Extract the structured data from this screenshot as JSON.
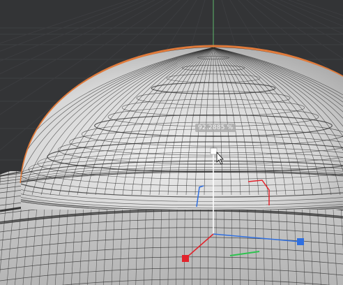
{
  "viewport": {
    "scale_readout": "92.2885 %"
  },
  "colors": {
    "background": "#333436",
    "grid_line": "#3e3f42",
    "y_axis_line": "#5fb86a",
    "selection_outline": "#e07a3a",
    "mesh_fill_light": "#e6e6e6",
    "mesh_fill_dark": "#9a9a9a",
    "wire": "#2a2a2a",
    "x_axis_handle": "#e2232b",
    "y_axis_handle": "#ffffff",
    "z_axis_handle": "#2f6fe0",
    "rotate_y_arc": "#2ec24f"
  },
  "icons": {
    "gizmo_center": "square-handle-icon",
    "cursor": "arrow-cursor-icon"
  }
}
